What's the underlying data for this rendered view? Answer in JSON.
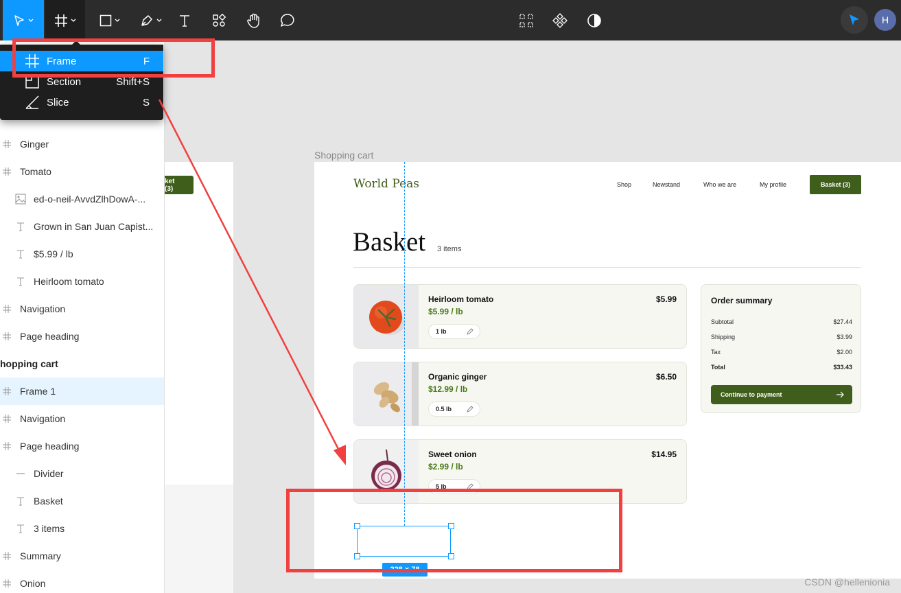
{
  "toolbar": {
    "tools": [
      "move-tool",
      "frame-tool",
      "shape-tool",
      "pen-tool",
      "text-tool",
      "resources-tool",
      "hand-tool",
      "comment-tool"
    ],
    "center_tools": [
      "components-icon",
      "plugins-icon",
      "contrast-icon"
    ],
    "avatar_initial": "H"
  },
  "frame_menu": {
    "items": [
      {
        "label": "Frame",
        "shortcut": "F",
        "icon": "frame-icon",
        "selected": true
      },
      {
        "label": "Section",
        "shortcut": "Shift+S",
        "icon": "section-icon",
        "selected": false
      },
      {
        "label": "Slice",
        "shortcut": "S",
        "icon": "slice-icon",
        "selected": false
      }
    ]
  },
  "layers": [
    {
      "label": "Ginger",
      "icon": "frame-icon",
      "indent": 0,
      "type": "frame"
    },
    {
      "label": "Tomato",
      "icon": "frame-icon",
      "indent": 0,
      "type": "frame"
    },
    {
      "label": "ed-o-neil-AvvdZlhDowA-...",
      "icon": "image-icon",
      "indent": 1,
      "type": "image"
    },
    {
      "label": "Grown in San Juan Capist...",
      "icon": "text-icon",
      "indent": 1,
      "type": "text"
    },
    {
      "label": "$5.99 / lb",
      "icon": "text-icon",
      "indent": 1,
      "type": "text"
    },
    {
      "label": "Heirloom tomato",
      "icon": "text-icon",
      "indent": 1,
      "type": "text"
    },
    {
      "label": "Navigation",
      "icon": "frame-icon",
      "indent": 0,
      "type": "frame"
    },
    {
      "label": "Page heading",
      "icon": "frame-icon",
      "indent": 0,
      "type": "frame"
    },
    {
      "label": "hopping cart",
      "icon": "",
      "indent": -1,
      "type": "group"
    },
    {
      "label": "Frame 1",
      "icon": "frame-icon",
      "indent": 0,
      "type": "frame",
      "selected": true
    },
    {
      "label": "Navigation",
      "icon": "frame-icon",
      "indent": 0,
      "type": "frame"
    },
    {
      "label": "Page heading",
      "icon": "frame-icon",
      "indent": 0,
      "type": "frame"
    },
    {
      "label": "Divider",
      "icon": "line-icon",
      "indent": 1,
      "type": "line"
    },
    {
      "label": "Basket",
      "icon": "text-icon",
      "indent": 1,
      "type": "text"
    },
    {
      "label": "3 items",
      "icon": "text-icon",
      "indent": 1,
      "type": "text"
    },
    {
      "label": "Summary",
      "icon": "frame-icon",
      "indent": 0,
      "type": "frame"
    },
    {
      "label": "Onion",
      "icon": "frame-icon",
      "indent": 0,
      "type": "frame"
    }
  ],
  "canvas": {
    "left_frame_button": "ket (3)",
    "frame_label": "Shopping cart",
    "brand": "World Peas",
    "nav": [
      "Shop",
      "Newstand",
      "Who we are",
      "My profile"
    ],
    "basket_button": "Basket (3)",
    "heading": "Basket",
    "items_count": "3 items",
    "products": [
      {
        "name": "Heirloom tomato",
        "price": "$5.99 / lb",
        "total": "$5.99",
        "qty": "1 lb",
        "image": "tomato"
      },
      {
        "name": "Organic ginger",
        "price": "$12.99 / lb",
        "total": "$6.50",
        "qty": "0.5 lb",
        "image": "ginger"
      },
      {
        "name": "Sweet onion",
        "price": "$2.99 / lb",
        "total": "$14.95",
        "qty": "5 lb",
        "image": "onion"
      }
    ],
    "summary": {
      "title": "Order summary",
      "rows": [
        {
          "label": "Subtotal",
          "value": "$27.44"
        },
        {
          "label": "Shipping",
          "value": "$3.99"
        },
        {
          "label": "Tax",
          "value": "$2.00"
        },
        {
          "label": "Total",
          "value": "$33.43"
        }
      ],
      "button": "Continue to payment"
    },
    "size_badge": "228 × 78"
  },
  "watermark": "CSDN @hellenionia",
  "colors": {
    "accent_blue": "#0d99ff",
    "brand_green": "#3f5e1b",
    "highlight_red": "#f04040",
    "toolbar_bg": "#2c2c2c"
  }
}
